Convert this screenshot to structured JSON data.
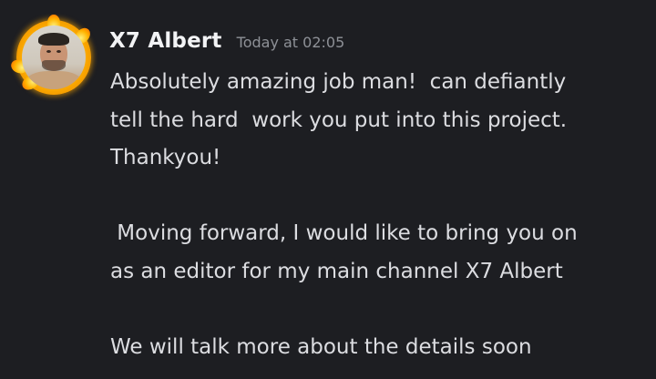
{
  "author": {
    "name": "X7 Albert",
    "timestamp": "Today at 02:05"
  },
  "message": {
    "lines": [
      "Absolutely amazing job man!  can defiantly",
      "tell the hard  work you put into this project.",
      "Thankyou!",
      "",
      " Moving forward, I would like to bring you on",
      "as an editor for my main channel X7 Albert",
      "",
      "We will talk more about the details soon"
    ]
  },
  "colors": {
    "background": "#1d1e22",
    "username": "#f2f3f5",
    "timestamp": "#8e9197",
    "message_text": "#dcdde1",
    "avatar_ring": "#ffb000"
  }
}
